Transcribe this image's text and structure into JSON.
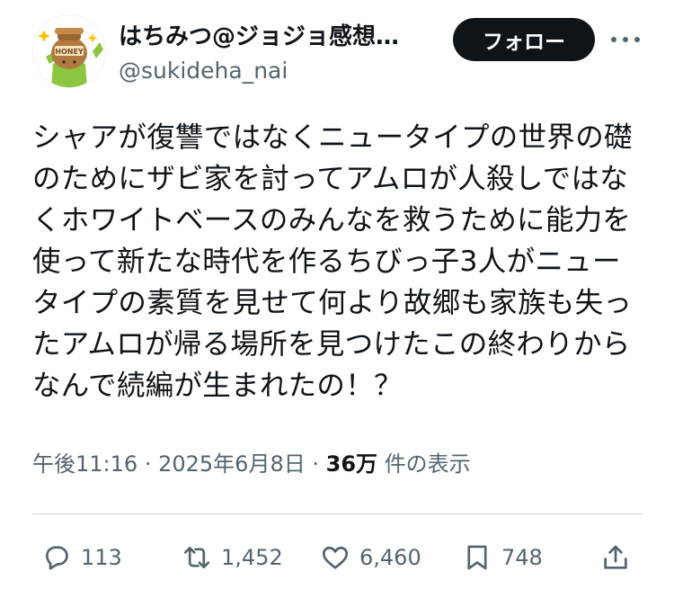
{
  "author": {
    "display_name": "はちみつ@ジョジョ感想…",
    "handle": "@sukideha_nai",
    "avatar_text": "HONEY"
  },
  "follow_label": "フォロー",
  "tweet": {
    "lines": [
      "シャアが復讐ではなくニュータイプの世界の礎",
      "のためにザビ家を討ってアムロが人殺しではな",
      "くホワイトベースのみんなを救うために能力を",
      "使って新たな時代を作るちびっ子3人がニュー",
      "タイプの素質を見せて何より故郷も家族も失っ",
      "たアムロが帰る場所を見つけたこの終わりから",
      "なんで続編が生まれたの！？"
    ]
  },
  "meta": {
    "time": "午後11:16",
    "separator": "·",
    "date": "2025年6月8日",
    "views_count": "36万",
    "views_label": "件の表示"
  },
  "actions": {
    "replies": "113",
    "retweets": "1,452",
    "likes": "6,460",
    "bookmarks": "748"
  },
  "icons": [
    "reply-icon",
    "retweet-icon",
    "like-icon",
    "bookmark-icon",
    "share-icon",
    "more-icon"
  ],
  "colors": {
    "text": "#0f1419",
    "secondary": "#536471",
    "divider": "#cfd9de",
    "button": "#0f1419"
  }
}
